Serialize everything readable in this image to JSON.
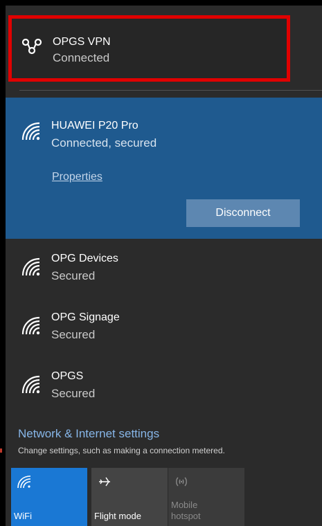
{
  "vpn": {
    "name": "OPGS VPN",
    "status": "Connected",
    "icon": "vpn-icon"
  },
  "active_network": {
    "name": "HUAWEI P20 Pro",
    "status": "Connected, secured",
    "properties_label": "Properties",
    "disconnect_label": "Disconnect",
    "icon": "wifi-icon"
  },
  "networks": [
    {
      "name": "OPG Devices",
      "status": "Secured"
    },
    {
      "name": "OPG Signage",
      "status": "Secured"
    },
    {
      "name": "OPGS",
      "status": "Secured"
    }
  ],
  "settings": {
    "title": "Network & Internet settings",
    "subtitle": "Change settings, such as making a connection metered."
  },
  "quick_actions": [
    {
      "label": "WiFi",
      "icon": "wifi-icon",
      "active": true
    },
    {
      "label": "Flight mode",
      "icon": "airplane-icon",
      "active": false
    },
    {
      "label": "Mobile\nhotspot",
      "icon": "hotspot-icon",
      "active": false,
      "disabled": true
    }
  ],
  "colors": {
    "highlight_border": "#e00000",
    "active_network_bg": "#1f5a8f",
    "disconnect_button_bg": "#5d87b1",
    "accent_link": "#87b6e8",
    "wifi_tile_bg": "#1a78d4"
  }
}
